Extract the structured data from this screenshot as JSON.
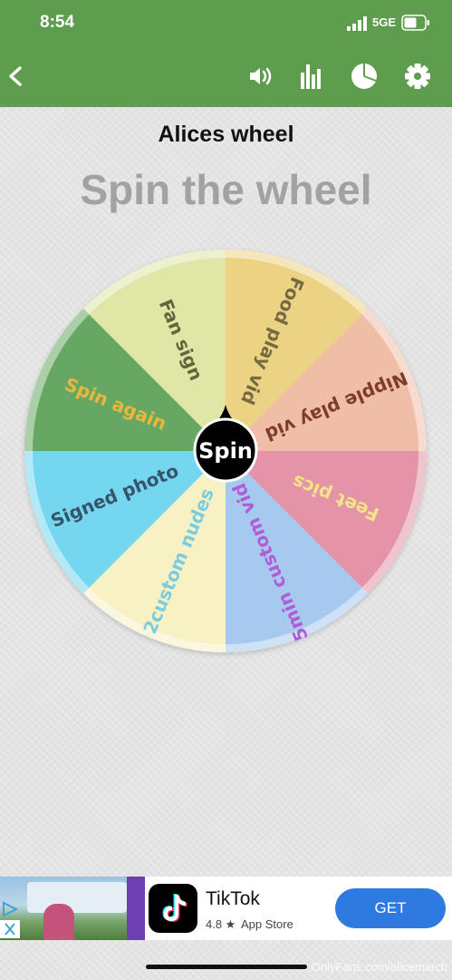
{
  "status_bar": {
    "time": "8:54",
    "network": "5GE"
  },
  "toolbar": {
    "back_icon": "chevron-left-icon",
    "sound_icon": "speaker-icon",
    "stats_icon": "bar-chart-icon",
    "pie_icon": "pie-chart-icon",
    "settings_icon": "gear-icon",
    "color": "#5e9d4e"
  },
  "wheel": {
    "name": "Alices wheel",
    "heading": "Spin the wheel",
    "spin_label": "Spin",
    "segments": [
      {
        "label": "Food play vid",
        "color": "#ecd383",
        "text_color": "#756a40"
      },
      {
        "label": "Nipple play vid",
        "color": "#f0bda6",
        "text_color": "#7c3d2c"
      },
      {
        "label": "Feet pics",
        "color": "#e493a8",
        "text_color": "#f4e488"
      },
      {
        "label": "5min custom vid",
        "color": "#a7c9ef",
        "text_color": "#b05cd6"
      },
      {
        "label": "2custom nudes",
        "color": "#f7f1c4",
        "text_color": "#78cde0"
      },
      {
        "label": "Signed photo",
        "color": "#74d7ef",
        "text_color": "#36556a"
      },
      {
        "label": "Spin again",
        "color": "#66a863",
        "text_color": "#eab63c"
      },
      {
        "label": "Fan sign",
        "color": "#dfe6a6",
        "text_color": "#66643b"
      }
    ]
  },
  "ad": {
    "app_name": "TikTok",
    "rating": "4.8 ★",
    "store": "App Store",
    "cta": "GET",
    "play_icon": "ad-choices-icon",
    "close_icon": "close-icon"
  },
  "watermark": "OnlyFans.com/alicemarch"
}
